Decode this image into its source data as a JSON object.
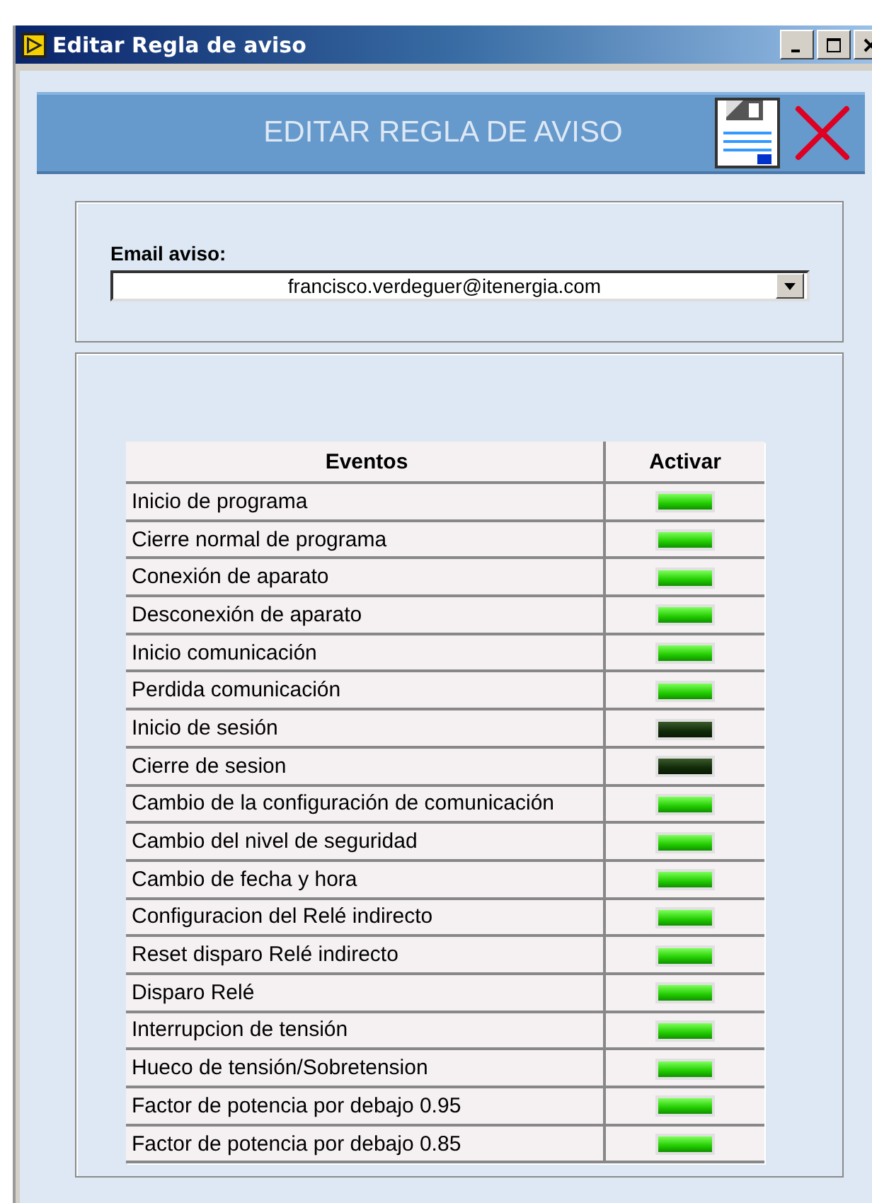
{
  "window": {
    "title": "Editar Regla de aviso"
  },
  "header": {
    "title": "EDITAR REGLA DE AVISO"
  },
  "email": {
    "label": "Email aviso:",
    "value": "francisco.verdeguer@itenergia.com"
  },
  "table": {
    "columns": [
      "Eventos",
      "Activar"
    ],
    "rows": [
      {
        "event": "Inicio de programa",
        "on": true
      },
      {
        "event": "Cierre normal de programa",
        "on": true
      },
      {
        "event": "Conexión de aparato",
        "on": true
      },
      {
        "event": "Desconexión de aparato",
        "on": true
      },
      {
        "event": "Inicio comunicación",
        "on": true
      },
      {
        "event": "Perdida comunicación",
        "on": true
      },
      {
        "event": "Inicio de sesión",
        "on": false
      },
      {
        "event": "Cierre de sesion",
        "on": false
      },
      {
        "event": "Cambio de la configuración de comunicación",
        "on": true
      },
      {
        "event": "Cambio del nivel de seguridad",
        "on": true
      },
      {
        "event": "Cambio de fecha y hora",
        "on": true
      },
      {
        "event": "Configuracion del Relé indirecto",
        "on": true
      },
      {
        "event": "Reset disparo Relé indirecto",
        "on": true
      },
      {
        "event": "Disparo Relé",
        "on": true
      },
      {
        "event": "Interrupcion de tensión",
        "on": true
      },
      {
        "event": "Hueco de tensión/Sobretension",
        "on": true
      },
      {
        "event": "Factor de potencia por debajo 0.95",
        "on": true
      },
      {
        "event": "Factor de potencia por debajo 0.85",
        "on": true
      }
    ]
  }
}
